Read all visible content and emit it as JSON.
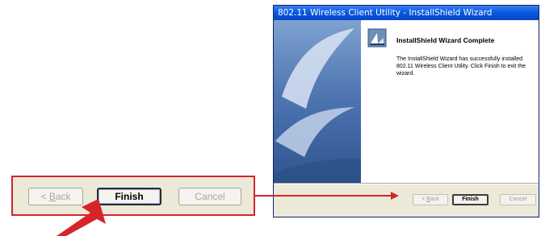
{
  "window": {
    "title": "802.11 Wireless Client Utility - InstallShield Wizard"
  },
  "wizard": {
    "heading": "InstallShield Wizard Complete",
    "message": "The InstallShield Wizard has successfully installed 802.11 Wireless Client Utility.  Click Finish to exit the wizard.",
    "icon": "installer-icon"
  },
  "buttons": {
    "back_prefix": "< ",
    "back_mnemonic": "B",
    "back_rest": "ack",
    "finish": "Finish",
    "cancel": "Cancel"
  },
  "colors": {
    "highlight": "#d6242a",
    "titlebar": "#0a5ae0"
  }
}
